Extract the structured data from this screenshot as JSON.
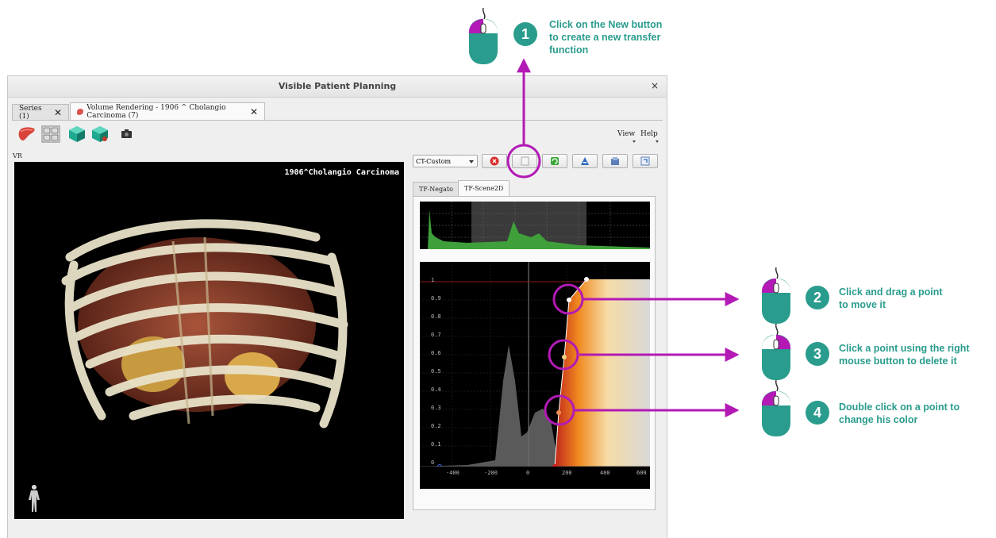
{
  "window": {
    "title": "Visible Patient Planning",
    "close_label": "×"
  },
  "tabs": [
    {
      "label": "Series (1)",
      "close": "✕"
    },
    {
      "label": "Volume Rendering - 1906 ^ Cholangio Carcinoma (7)",
      "close": "✕"
    }
  ],
  "toolbar": {
    "icons": [
      "liver-icon",
      "layout-icon",
      "volume-cube-icon",
      "volume-cube-icon",
      "camera-icon"
    ]
  },
  "menus": {
    "view": "View",
    "help": "Help"
  },
  "vr": {
    "label": "VR",
    "patient_name": "1906^Cholangio Carcinoma"
  },
  "tf_toolbar": {
    "preset": "CT-Custom",
    "buttons": [
      "delete-icon",
      "new-icon",
      "reset-icon",
      "rename-icon",
      "import-icon",
      "export-icon"
    ]
  },
  "tf_tabs": [
    "TF-Negato",
    "TF-Scene2D"
  ],
  "tf_axis": {
    "y_ticks": [
      "1",
      "0.9",
      "0.8",
      "0.7",
      "0.6",
      "0.5",
      "0.4",
      "0.3",
      "0.2",
      "0.1",
      "0"
    ],
    "x_ticks": [
      "-400",
      "-200",
      "0",
      "200",
      "400",
      "600"
    ]
  },
  "colors": {
    "accent": "#2a9c8d",
    "annotation": "#b31ab5"
  },
  "annotations": [
    {
      "number": "1",
      "text_lines": [
        "Click on the New button",
        "to create a new transfer",
        "function"
      ]
    },
    {
      "number": "2",
      "text_lines": [
        "Click and drag a point",
        "to move it"
      ]
    },
    {
      "number": "3",
      "text_lines": [
        "Click a point using the right",
        "mouse button to delete it"
      ]
    },
    {
      "number": "4",
      "text_lines": [
        "Double click on a point to",
        "change his color"
      ]
    }
  ]
}
